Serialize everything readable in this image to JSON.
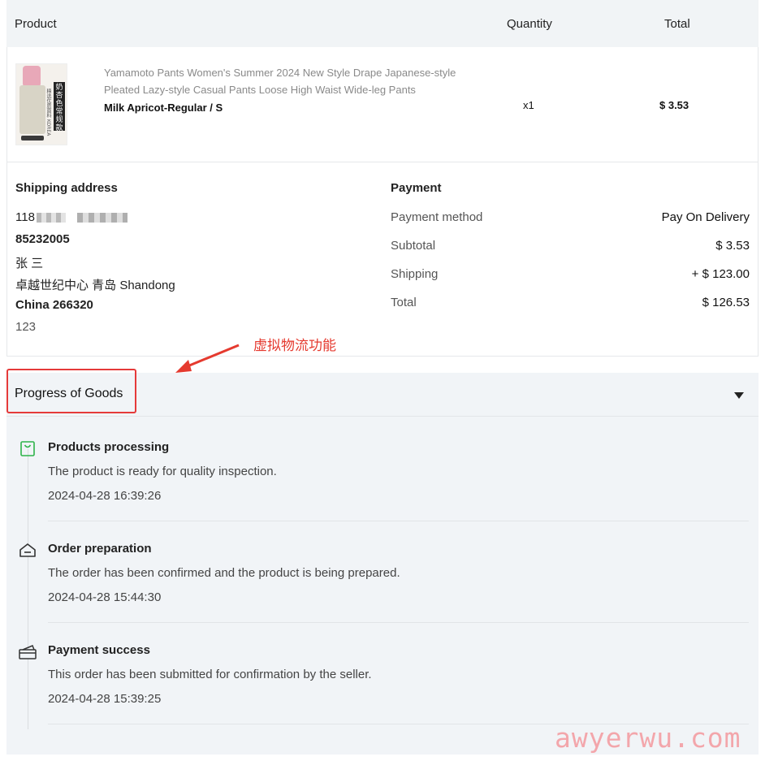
{
  "table": {
    "col_product": "Product",
    "col_quantity": "Quantity",
    "col_total": "Total"
  },
  "item": {
    "title": "Yamamoto Pants Women's Summer 2024 New Style Drape Japanese-style Pleated Lazy-style Casual Pants Loose High Waist Wide-leg Pants",
    "variant": "Milk Apricot-Regular / S",
    "quantity": "x1",
    "total": "$ 3.53",
    "thumb_label": "奶杏色常规款",
    "thumb_side": "精选优质面料 KOREA"
  },
  "shipping": {
    "heading": "Shipping address",
    "line1": "118",
    "phone": "85232005",
    "name": "张 三",
    "address": "卓越世纪中心 青岛 Shandong",
    "country_zip": "China 266320",
    "extra": "123"
  },
  "payment": {
    "heading": "Payment",
    "method_label": "Payment method",
    "method_value": "Pay On Delivery",
    "subtotal_label": "Subtotal",
    "subtotal_value": "$ 3.53",
    "shipping_label": "Shipping",
    "shipping_value": "+ $ 123.00",
    "total_label": "Total",
    "total_value": "$ 126.53"
  },
  "annotation": {
    "text": "虚拟物流功能",
    "color": "#e53a2f"
  },
  "progress": {
    "title": "Progress of Goods",
    "steps": [
      {
        "icon": "shopping-bag-icon",
        "title": "Products processing",
        "desc": "The product is ready for quality inspection.",
        "time": "2024-04-28 16:39:26"
      },
      {
        "icon": "house-icon",
        "title": "Order preparation",
        "desc": "The order has been confirmed and the product is being prepared.",
        "time": "2024-04-28 15:44:30"
      },
      {
        "icon": "payment-card-icon",
        "title": "Payment success",
        "desc": "This order has been submitted for confirmation by the seller.",
        "time": "2024-04-28 15:39:25"
      }
    ]
  },
  "watermark": "awyerwu.com"
}
